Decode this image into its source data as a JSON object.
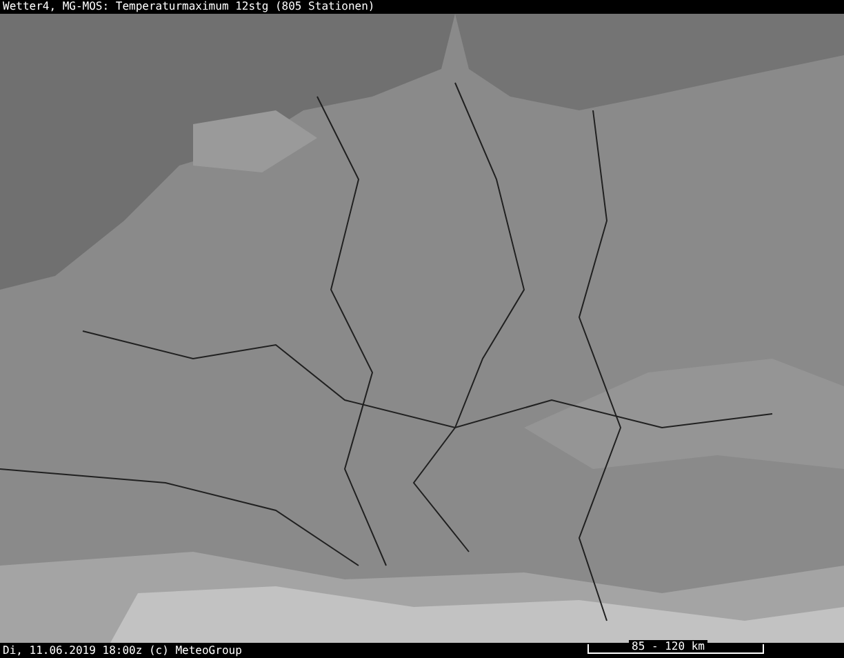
{
  "window": {
    "title": "Wetter4, MG-MOS: Temperaturmaximum 12stg (805 Stationen)"
  },
  "status_bar": {
    "text": "Di, 11.06.2019 18:00z (c) MeteoGroup",
    "scale": "85 - 120 km"
  }
}
